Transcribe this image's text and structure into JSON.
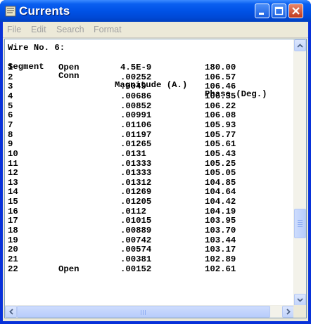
{
  "window": {
    "title": "Currents"
  },
  "menu": {
    "items": [
      "File",
      "Edit",
      "Search",
      "Format"
    ]
  },
  "output": {
    "heading": "Wire No. 6:",
    "columns": {
      "segment": "Segment",
      "conn": "Conn",
      "magnitude": "Magnitude (A.)",
      "phase": "Phase (Deg.)"
    },
    "rows": [
      {
        "segment": "1",
        "conn": "Open",
        "magnitude": "4.5E-9",
        "phase": "180.00"
      },
      {
        "segment": "2",
        "conn": "",
        "magnitude": ".00252",
        "phase": "106.57"
      },
      {
        "segment": "3",
        "conn": "",
        "magnitude": ".0049",
        "phase": "106.46"
      },
      {
        "segment": "4",
        "conn": "",
        "magnitude": ".00686",
        "phase": "106.35"
      },
      {
        "segment": "5",
        "conn": "",
        "magnitude": ".00852",
        "phase": "106.22"
      },
      {
        "segment": "6",
        "conn": "",
        "magnitude": ".00991",
        "phase": "106.08"
      },
      {
        "segment": "7",
        "conn": "",
        "magnitude": ".01106",
        "phase": "105.93"
      },
      {
        "segment": "8",
        "conn": "",
        "magnitude": ".01197",
        "phase": "105.77"
      },
      {
        "segment": "9",
        "conn": "",
        "magnitude": ".01265",
        "phase": "105.61"
      },
      {
        "segment": "10",
        "conn": "",
        "magnitude": ".0131",
        "phase": "105.43"
      },
      {
        "segment": "11",
        "conn": "",
        "magnitude": ".01333",
        "phase": "105.25"
      },
      {
        "segment": "12",
        "conn": "",
        "magnitude": ".01333",
        "phase": "105.05"
      },
      {
        "segment": "13",
        "conn": "",
        "magnitude": ".01312",
        "phase": "104.85"
      },
      {
        "segment": "14",
        "conn": "",
        "magnitude": ".01269",
        "phase": "104.64"
      },
      {
        "segment": "15",
        "conn": "",
        "magnitude": ".01205",
        "phase": "104.42"
      },
      {
        "segment": "16",
        "conn": "",
        "magnitude": ".0112",
        "phase": "104.19"
      },
      {
        "segment": "17",
        "conn": "",
        "magnitude": ".01015",
        "phase": "103.95"
      },
      {
        "segment": "18",
        "conn": "",
        "magnitude": ".00889",
        "phase": "103.70"
      },
      {
        "segment": "19",
        "conn": "",
        "magnitude": ".00742",
        "phase": "103.44"
      },
      {
        "segment": "20",
        "conn": "",
        "magnitude": ".00574",
        "phase": "103.17"
      },
      {
        "segment": "21",
        "conn": "",
        "magnitude": ".00381",
        "phase": "102.89"
      },
      {
        "segment": "22",
        "conn": "Open",
        "magnitude": ".00152",
        "phase": "102.61"
      }
    ]
  },
  "scroll": {
    "vertical_position": 0.74,
    "horizontal_position": 0.0
  },
  "icons": {
    "app": "currents-app-icon",
    "minimize": "minimize-icon",
    "maximize": "maximize-icon",
    "close": "close-icon",
    "up": "arrow-up-icon",
    "down": "arrow-down-icon",
    "left": "arrow-left-icon",
    "right": "arrow-right-icon"
  }
}
